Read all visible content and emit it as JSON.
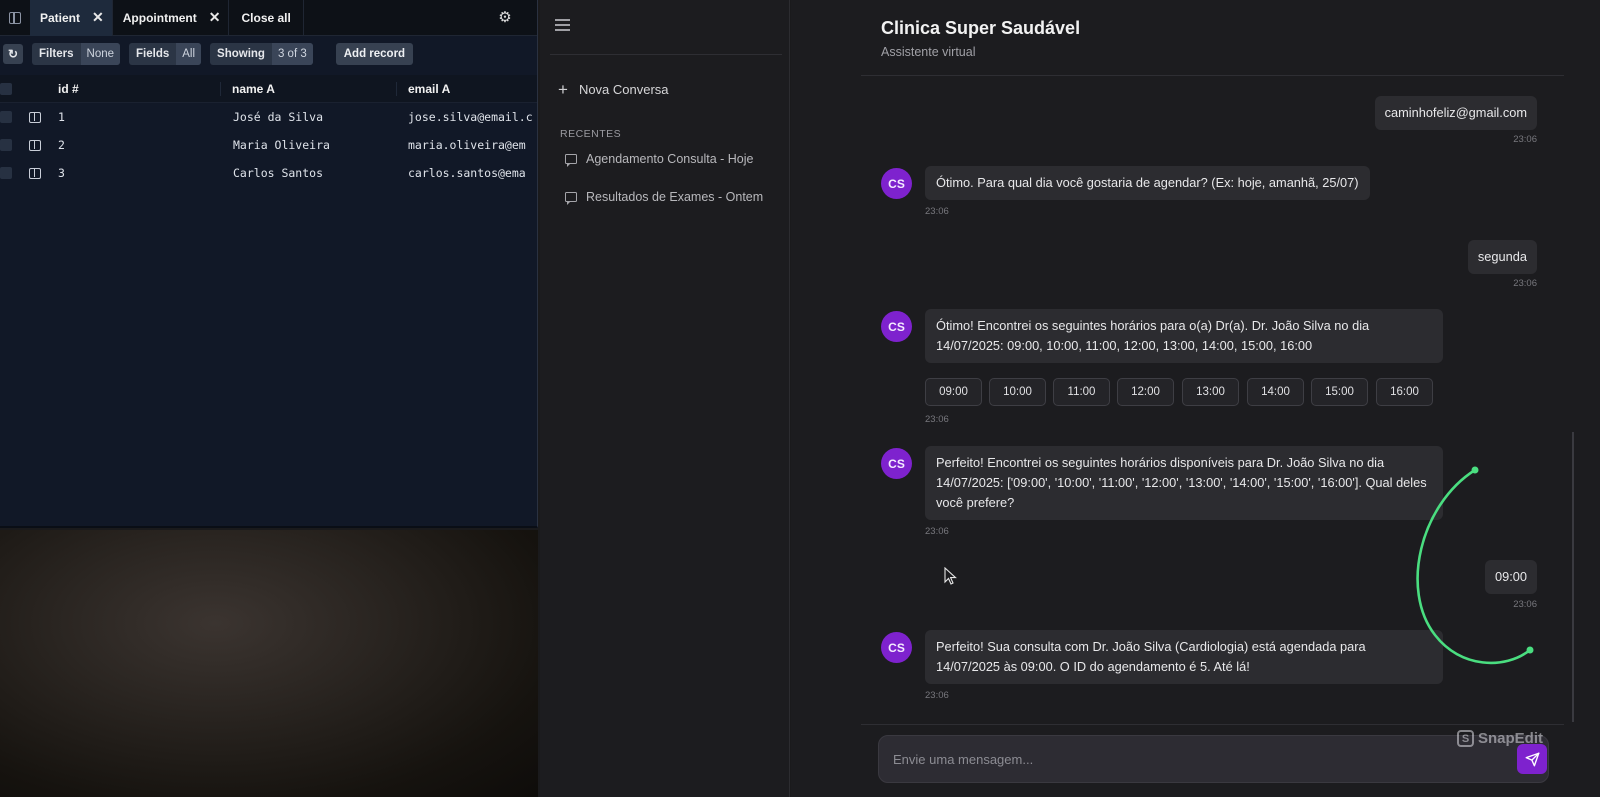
{
  "db": {
    "tabs": [
      {
        "label": "Patient",
        "active": true
      },
      {
        "label": "Appointment",
        "active": false
      }
    ],
    "close_all": "Close all",
    "toolbar": {
      "filters_label": "Filters",
      "filters_value": "None",
      "fields_label": "Fields",
      "fields_value": "All",
      "showing_label": "Showing",
      "showing_value": "3 of 3",
      "add_record": "Add record"
    },
    "columns": {
      "id": "id #",
      "name": "name A",
      "email": "email A"
    },
    "rows": [
      {
        "id": "1",
        "name": "José da Silva",
        "email": "jose.silva@email.c"
      },
      {
        "id": "2",
        "name": "Maria Oliveira",
        "email": "maria.oliveira@em"
      },
      {
        "id": "3",
        "name": "Carlos Santos",
        "email": "carlos.santos@ema"
      }
    ]
  },
  "sidebar": {
    "new_conversation": "Nova Conversa",
    "recent_label": "RECENTES",
    "recent_items": [
      {
        "label": "Agendamento Consulta - Hoje"
      },
      {
        "label": "Resultados de Exames - Ontem"
      }
    ]
  },
  "chat": {
    "title": "Clinica Super Saudável",
    "subtitle": "Assistente virtual",
    "avatar_initials": "CS",
    "messages": [
      {
        "role": "user",
        "text": "caminhofeliz@gmail.com",
        "time": "23:06"
      },
      {
        "role": "bot",
        "text": "Ótimo. Para qual dia você gostaria de agendar? (Ex: hoje, amanhã, 25/07)",
        "time": "23:06"
      },
      {
        "role": "user",
        "text": "segunda",
        "time": "23:06"
      },
      {
        "role": "bot",
        "text": "Ótimo! Encontrei os seguintes horários para o(a) Dr(a). Dr. João Silva no dia 14/07/2025: 09:00, 10:00, 11:00, 12:00, 13:00, 14:00, 15:00, 16:00",
        "time": "23:06"
      },
      {
        "role": "bot",
        "text": "Perfeito! Encontrei os seguintes horários disponíveis para Dr. João Silva no dia 14/07/2025: ['09:00', '10:00', '11:00', '12:00', '13:00', '14:00', '15:00', '16:00']. Qual deles você prefere?",
        "time": "23:06"
      },
      {
        "role": "user",
        "text": "09:00",
        "time": "23:06"
      },
      {
        "role": "bot",
        "text": "Perfeito! Sua consulta com Dr. João Silva (Cardiologia) está agendada para 14/07/2025 às 09:00. O ID do agendamento é 5. Até lá!",
        "time": "23:06"
      }
    ],
    "time_slots": [
      "09:00",
      "10:00",
      "11:00",
      "12:00",
      "13:00",
      "14:00",
      "15:00",
      "16:00"
    ],
    "input_placeholder": "Envie uma mensagem...",
    "watermark": "SnapEdit"
  },
  "colors": {
    "accent": "#7e22ce",
    "highlight_arc": "#4ade80"
  }
}
